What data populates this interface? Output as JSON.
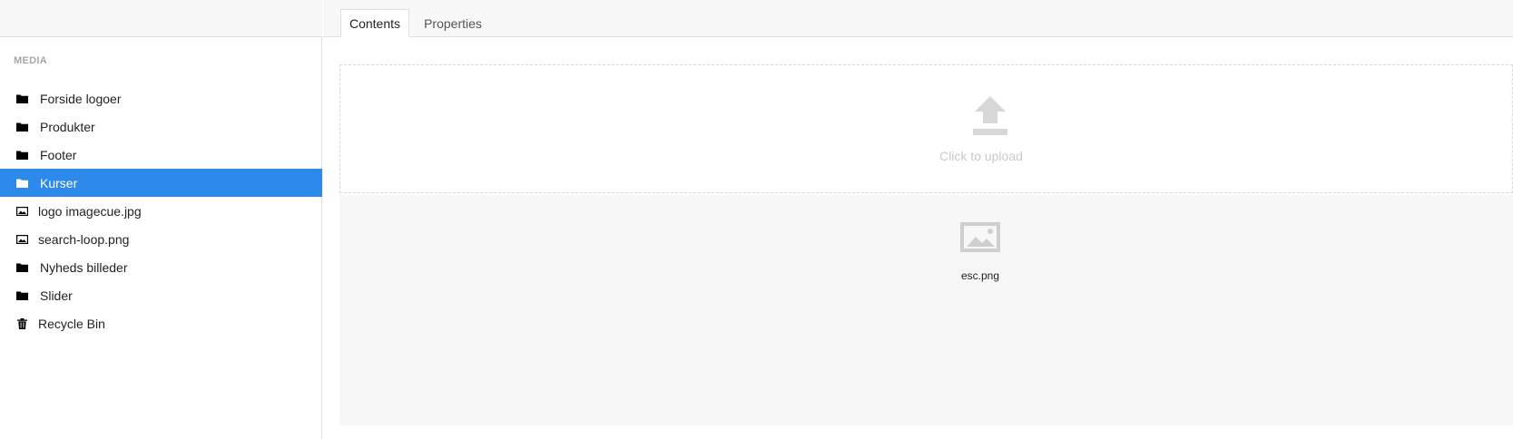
{
  "sidebar": {
    "section_title": "MEDIA",
    "items": [
      {
        "label": "Forside logoer",
        "icon": "folder-icon"
      },
      {
        "label": "Produkter",
        "icon": "folder-icon"
      },
      {
        "label": "Footer",
        "icon": "folder-icon"
      },
      {
        "label": "Kurser",
        "icon": "folder-icon",
        "selected": true
      },
      {
        "label": "logo imagecue.jpg",
        "icon": "image-icon"
      },
      {
        "label": "search-loop.png",
        "icon": "image-icon"
      },
      {
        "label": "Nyheds billeder",
        "icon": "folder-icon"
      },
      {
        "label": "Slider",
        "icon": "folder-icon"
      },
      {
        "label": "Recycle Bin",
        "icon": "trash-icon"
      }
    ]
  },
  "tabs": [
    {
      "label": "Contents",
      "active": true
    },
    {
      "label": "Properties",
      "active": false
    }
  ],
  "upload": {
    "label": "Click to upload",
    "icon": "upload-icon"
  },
  "media_items": [
    {
      "name": "esc.png",
      "icon": "image-icon"
    }
  ],
  "colors": {
    "accent": "#2e8aea",
    "header_bg": "#f7f7f7",
    "border": "#e0e0e0",
    "muted_text": "#c9c9c9",
    "section_title": "#a6a6a6"
  }
}
